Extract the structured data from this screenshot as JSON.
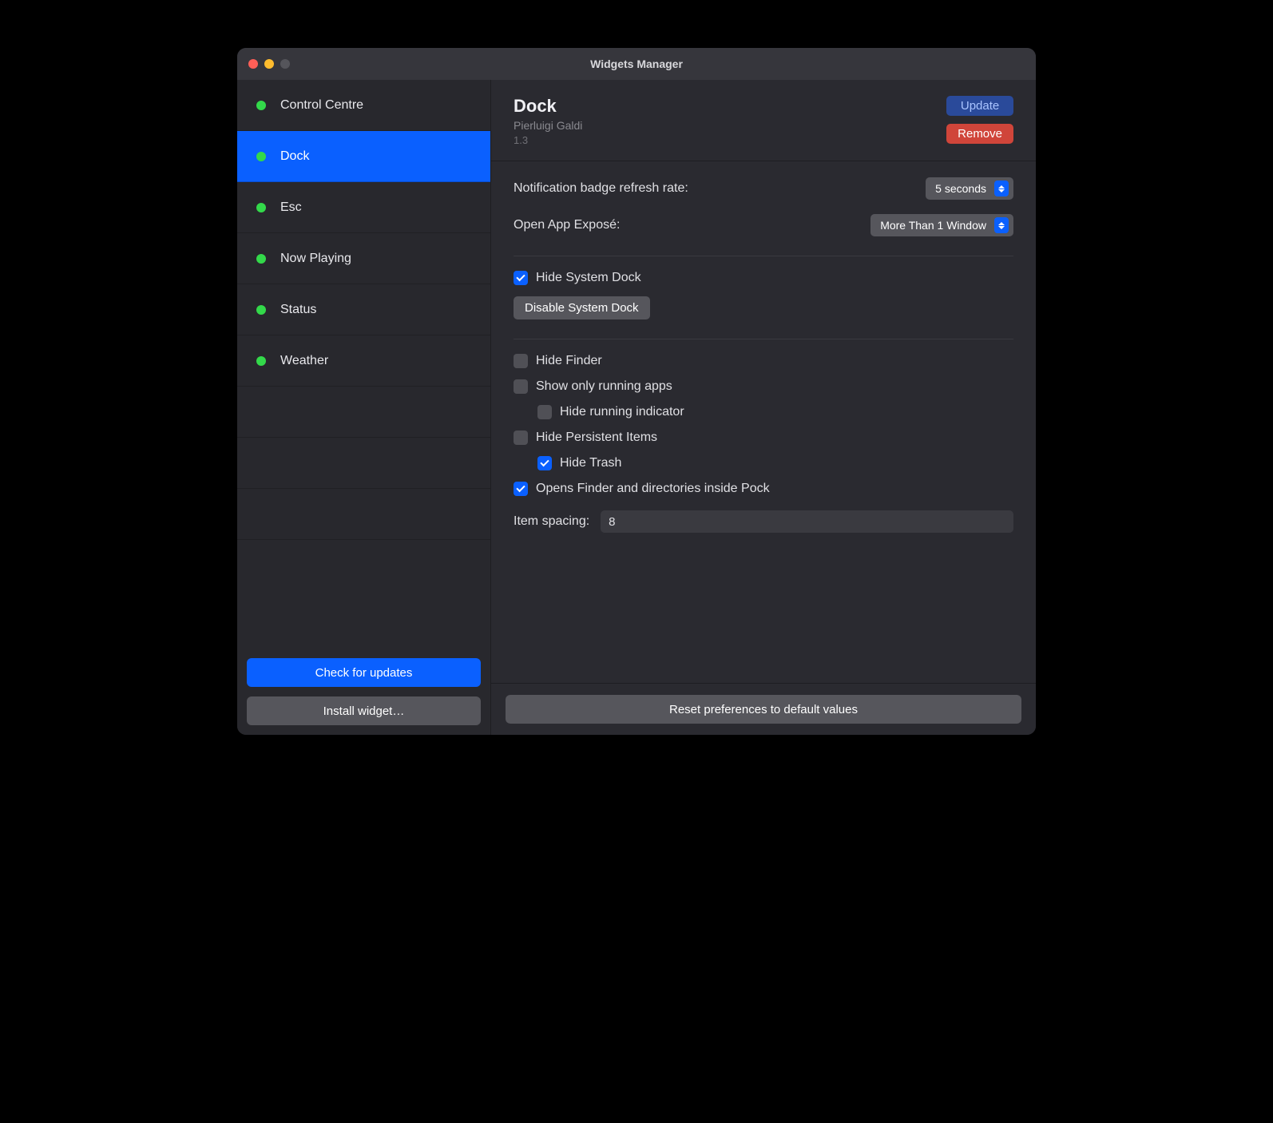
{
  "window": {
    "title": "Widgets Manager"
  },
  "sidebar": {
    "items": [
      {
        "label": "Control Centre"
      },
      {
        "label": "Dock"
      },
      {
        "label": "Esc"
      },
      {
        "label": "Now Playing"
      },
      {
        "label": "Status"
      },
      {
        "label": "Weather"
      }
    ],
    "selected_index": 1,
    "check_updates_label": "Check for updates",
    "install_label": "Install widget…"
  },
  "header": {
    "title": "Dock",
    "author": "Pierluigi Galdi",
    "version": "1.3",
    "update_label": "Update",
    "remove_label": "Remove"
  },
  "settings": {
    "refresh_label": "Notification badge refresh rate:",
    "refresh_value": "5 seconds",
    "expose_label": "Open App Exposé:",
    "expose_value": "More Than 1 Window",
    "hide_system_dock_label": "Hide System Dock",
    "hide_system_dock_checked": true,
    "disable_system_dock_label": "Disable System Dock",
    "hide_finder_label": "Hide Finder",
    "hide_finder_checked": false,
    "show_only_running_label": "Show only running apps",
    "show_only_running_checked": false,
    "hide_running_indicator_label": "Hide running indicator",
    "hide_running_indicator_checked": false,
    "hide_persistent_label": "Hide Persistent Items",
    "hide_persistent_checked": false,
    "hide_trash_label": "Hide Trash",
    "hide_trash_checked": true,
    "opens_finder_label": "Opens Finder and directories inside Pock",
    "opens_finder_checked": true,
    "item_spacing_label": "Item spacing:",
    "item_spacing_value": "8"
  },
  "footer": {
    "reset_label": "Reset preferences to default values"
  }
}
